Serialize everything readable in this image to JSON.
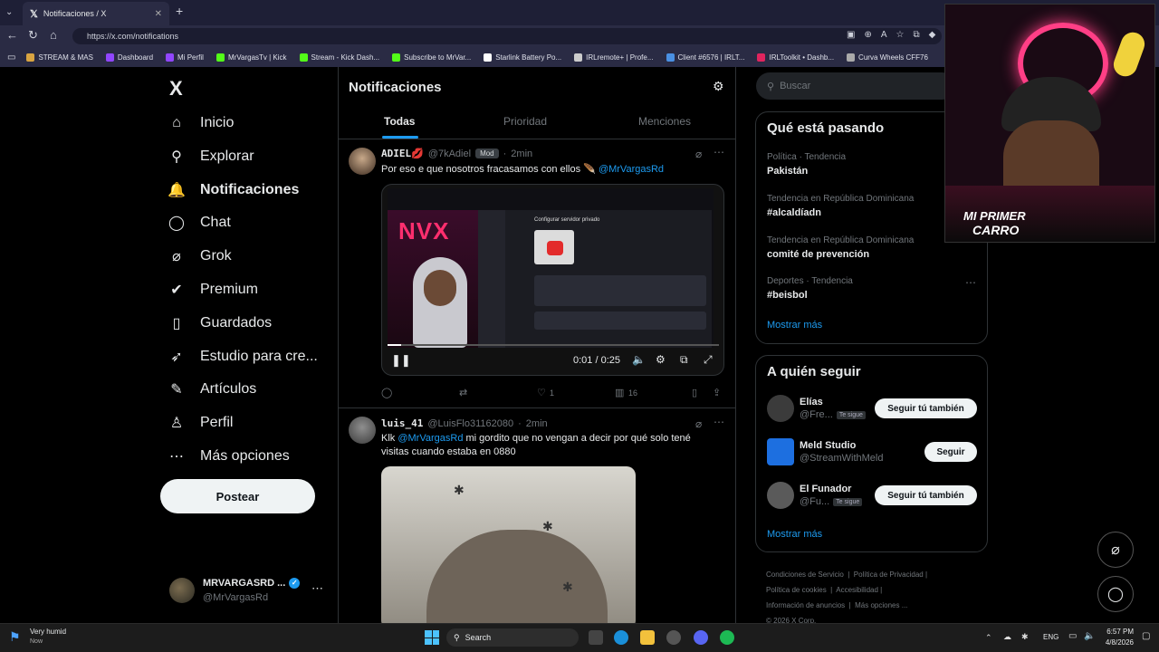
{
  "browser": {
    "tab_title": "Notificaciones / X",
    "url": "https://x.com/notifications",
    "bookmarks": [
      {
        "label": "STREAM & MAS",
        "color": "#d9a441"
      },
      {
        "label": "Dashboard",
        "color": "#9146ff"
      },
      {
        "label": "Mi Perfil",
        "color": "#9146ff"
      },
      {
        "label": "MrVargasTv | Kick",
        "color": "#53fc18"
      },
      {
        "label": "Stream - Kick Dash...",
        "color": "#53fc18"
      },
      {
        "label": "Subscribe to MrVar...",
        "color": "#53fc18"
      },
      {
        "label": "Starlink Battery Po...",
        "color": "#ffffff"
      },
      {
        "label": "IRLremote+ | Profe...",
        "color": "#cccccc"
      },
      {
        "label": "Client #6576 | IRLT...",
        "color": "#4a90e2"
      },
      {
        "label": "IRLToolkit • Dashb...",
        "color": "#e0245e"
      },
      {
        "label": "Curva Wheels CFF76",
        "color": "#aaaaaa"
      }
    ]
  },
  "nav": {
    "logo": "X",
    "items": [
      {
        "label": "Inicio",
        "icon": "home-icon",
        "glyph": "⌂"
      },
      {
        "label": "Explorar",
        "icon": "search-icon",
        "glyph": "⚲"
      },
      {
        "label": "Notificaciones",
        "icon": "bell-icon",
        "glyph": "🔔"
      },
      {
        "label": "Chat",
        "icon": "chat-icon",
        "glyph": "◯"
      },
      {
        "label": "Grok",
        "icon": "grok-icon",
        "glyph": "⌀"
      },
      {
        "label": "Premium",
        "icon": "premium-icon",
        "glyph": "✔"
      },
      {
        "label": "Guardados",
        "icon": "bookmark-icon",
        "glyph": "▯"
      },
      {
        "label": "Estudio para cre...",
        "icon": "rocket-icon",
        "glyph": "➶"
      },
      {
        "label": "Artículos",
        "icon": "article-icon",
        "glyph": "✎"
      },
      {
        "label": "Perfil",
        "icon": "profile-icon",
        "glyph": "♙"
      },
      {
        "label": "Más opciones",
        "icon": "more-icon",
        "glyph": "⋯"
      }
    ],
    "post_button": "Postear",
    "account": {
      "name": "MRVARGASRD ...",
      "handle": "@MrVargasRd"
    }
  },
  "feed": {
    "title": "Notificaciones",
    "tabs": [
      "Todas",
      "Prioridad",
      "Menciones"
    ],
    "active_tab": "Todas",
    "tweets": [
      {
        "name": "ADIEL💋",
        "handle": "@7kAdiel",
        "badge": "Mod",
        "time": "2min",
        "text": "Por eso e que nosotros fracasamos con ellos 🪶",
        "mention": "@MrVargasRd",
        "video_time": "0:01 / 0:25",
        "video_overlay": "NVX",
        "video_panel_title": "Configurar servidor privado",
        "likes": "1",
        "views": "16"
      },
      {
        "name": "luis_41",
        "handle": "@LuisFlo31162080",
        "time": "2min",
        "text_prefix": "Klk",
        "mention": "@MrVargasRd",
        "text": "mi gordito que no vengan a decir por qué solo tené visitas cuando estaba en 0880"
      }
    ]
  },
  "sidebar": {
    "search_placeholder": "Buscar",
    "trends_title": "Qué está pasando",
    "trends": [
      {
        "meta": "Política · Tendencia",
        "title": "Pakistán"
      },
      {
        "meta": "Tendencia en República Dominicana",
        "title": "#alcaldíadn"
      },
      {
        "meta": "Tendencia en República Dominicana",
        "title": "comité de prevención"
      },
      {
        "meta": "Deportes · Tendencia",
        "title": "#beisbol"
      }
    ],
    "show_more": "Mostrar más",
    "follow_title": "A quién seguir",
    "follow": [
      {
        "name": "Elías",
        "handle": "@Fre...",
        "tag": "Te sigue",
        "button": "Seguir tú también"
      },
      {
        "name": "Meld Studio",
        "handle": "@StreamWithMeld",
        "tag": "",
        "button": "Seguir"
      },
      {
        "name": "El Funador",
        "handle": "@Fu...",
        "tag": "Te sigue",
        "button": "Seguir tú también"
      }
    ],
    "show_more2": "Mostrar más",
    "footer": [
      "Condiciones de Servicio",
      "Política de Privacidad",
      "Política de cookies",
      "Accesibilidad",
      "Información de anuncios",
      "Más opciones ...",
      "© 2026 X Corp."
    ]
  },
  "webcam": {
    "banner_line1": "MI PRIMER",
    "banner_line2": "CARRO"
  },
  "taskbar": {
    "weather_title": "Very humid",
    "weather_sub": "Now",
    "search": "Search",
    "lang": "ENG",
    "time": "6:57 PM",
    "date": "4/8/2026"
  }
}
